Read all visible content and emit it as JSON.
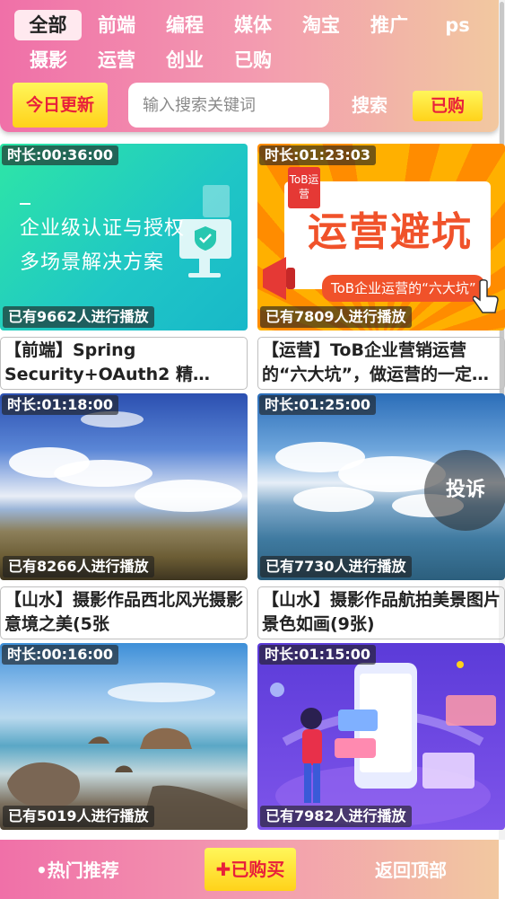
{
  "categories": [
    {
      "label": "全部",
      "active": true
    },
    {
      "label": "前端"
    },
    {
      "label": "编程"
    },
    {
      "label": "媒体"
    },
    {
      "label": "淘宝"
    },
    {
      "label": "推广"
    },
    {
      "label": "ps"
    },
    {
      "label": "摄影"
    },
    {
      "label": "运营"
    },
    {
      "label": "创业"
    },
    {
      "label": "已购"
    }
  ],
  "toolbar": {
    "today_label": "今日更新",
    "search_placeholder": "输入搜索关键词",
    "search_label": "搜索",
    "bought_label": "已购"
  },
  "videos": [
    {
      "duration": "时长:00:36:00",
      "plays": "已有9662人进行播放",
      "title": "【前端】Spring Security+OAuth2 精讲，…",
      "art_lines": [
        "企业级认证与授权",
        "多场景解决方案"
      ]
    },
    {
      "duration": "时长:01:23:03",
      "plays": "已有7809人进行播放",
      "title": "【运营】ToB企业营销运营的“六大坑”，做运营的一定…",
      "art_tag": "ToB运营",
      "art_big": "运营避坑",
      "art_sub": "ToB企业运营的“六大坑”"
    },
    {
      "duration": "时长:01:18:00",
      "plays": "已有8266人进行播放",
      "title": "【山水】摄影作品西北风光摄影 意境之美(5张"
    },
    {
      "duration": "时长:01:25:00",
      "plays": "已有7730人进行播放",
      "title": "【山水】摄影作品航拍美景图片 景色如画(9张)"
    },
    {
      "duration": "时长:00:16:00",
      "plays": "已有5019人进行播放",
      "title": ""
    },
    {
      "duration": "时长:01:15:00",
      "plays": "已有7982人进行播放",
      "title": ""
    }
  ],
  "report_label": "投诉",
  "footer": {
    "hot_label": "•热门推荐",
    "buy_label": "✚已购买",
    "top_label": "返回顶部"
  },
  "colors": {
    "header_gradient_start": "#f070a8",
    "header_gradient_end": "#f2c8a0",
    "accent_yellow": "#ffd21a",
    "accent_red": "#e8203a"
  }
}
